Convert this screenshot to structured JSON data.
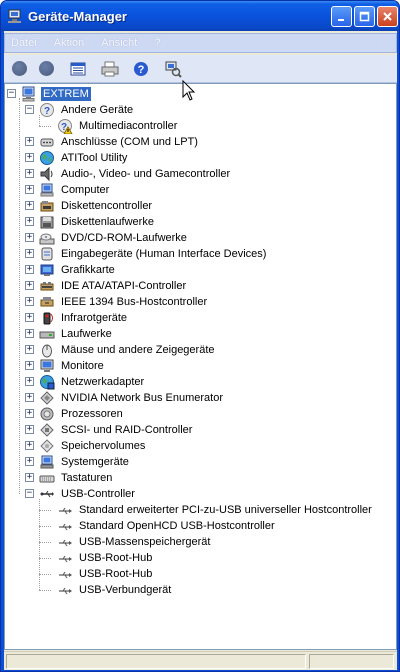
{
  "window": {
    "title": "Geräte-Manager"
  },
  "menu": [
    "Datei",
    "Aktion",
    "Ansicht",
    "?"
  ],
  "toolbar": [
    {
      "name": "back-button",
      "icon": "back-circle-icon"
    },
    {
      "name": "forward-button",
      "icon": "forward-circle-icon"
    },
    {
      "name": "properties-view-button",
      "icon": "list-view-icon"
    },
    {
      "name": "print-button",
      "icon": "printer-icon"
    },
    {
      "name": "help-button",
      "icon": "help-icon"
    },
    {
      "name": "scan-hardware-button",
      "icon": "scan-hardware-icon"
    }
  ],
  "tree": {
    "root": "EXTREM",
    "categories": [
      {
        "label": "Andere Geräte",
        "icon": "unknown-device-icon",
        "expanded": true,
        "children": [
          {
            "label": "Multimediacontroller",
            "icon": "warning-device-icon"
          }
        ]
      },
      {
        "label": "Anschlüsse (COM und LPT)",
        "icon": "port-icon"
      },
      {
        "label": "ATITool Utility",
        "icon": "globe-icon"
      },
      {
        "label": "Audio-, Video- und Gamecontroller",
        "icon": "speaker-icon"
      },
      {
        "label": "Computer",
        "icon": "computer-icon"
      },
      {
        "label": "Diskettencontroller",
        "icon": "floppy-controller-icon"
      },
      {
        "label": "Diskettenlaufwerke",
        "icon": "floppy-drive-icon"
      },
      {
        "label": "DVD/CD-ROM-Laufwerke",
        "icon": "cd-drive-icon"
      },
      {
        "label": "Eingabegeräte (Human Interface Devices)",
        "icon": "hid-icon"
      },
      {
        "label": "Grafikkarte",
        "icon": "display-adapter-icon"
      },
      {
        "label": "IDE ATA/ATAPI-Controller",
        "icon": "ide-controller-icon"
      },
      {
        "label": "IEEE 1394 Bus-Hostcontroller",
        "icon": "firewire-icon"
      },
      {
        "label": "Infrarotgeräte",
        "icon": "infrared-icon"
      },
      {
        "label": "Laufwerke",
        "icon": "disk-drive-icon"
      },
      {
        "label": "Mäuse und andere Zeigegeräte",
        "icon": "mouse-icon"
      },
      {
        "label": "Monitore",
        "icon": "monitor-icon"
      },
      {
        "label": "Netzwerkadapter",
        "icon": "network-adapter-icon"
      },
      {
        "label": "NVIDIA Network Bus Enumerator",
        "icon": "bus-enumerator-icon"
      },
      {
        "label": "Prozessoren",
        "icon": "processor-icon"
      },
      {
        "label": "SCSI- und RAID-Controller",
        "icon": "scsi-icon"
      },
      {
        "label": "Speichervolumes",
        "icon": "storage-volume-icon"
      },
      {
        "label": "Systemgeräte",
        "icon": "system-device-icon"
      },
      {
        "label": "Tastaturen",
        "icon": "keyboard-icon"
      },
      {
        "label": "USB-Controller",
        "icon": "usb-icon",
        "expanded": true,
        "children": [
          {
            "label": "Standard erweiterter PCI-zu-USB universeller Hostcontroller",
            "icon": "usb-plug-icon"
          },
          {
            "label": "Standard OpenHCD USB-Hostcontroller",
            "icon": "usb-plug-icon"
          },
          {
            "label": "USB-Massenspeichergerät",
            "icon": "usb-plug-icon"
          },
          {
            "label": "USB-Root-Hub",
            "icon": "usb-plug-icon"
          },
          {
            "label": "USB-Root-Hub",
            "icon": "usb-plug-icon"
          },
          {
            "label": "USB-Verbundgerät",
            "icon": "usb-plug-icon"
          }
        ]
      }
    ]
  }
}
